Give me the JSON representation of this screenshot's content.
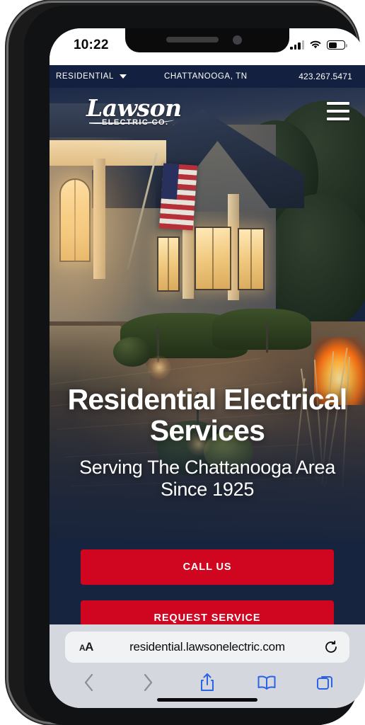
{
  "status_bar": {
    "time": "10:22",
    "signal_icon": "cellular-signal-icon",
    "wifi_icon": "wifi-icon",
    "battery_icon": "battery-icon"
  },
  "site": {
    "utility_bar": {
      "segment_label": "RESIDENTIAL",
      "segment_chevron_icon": "chevron-down-icon",
      "location": "CHATTANOOGA, TN",
      "phone": "423.267.5471"
    },
    "header": {
      "logo_script": "Lawson",
      "logo_subtitle": "ELECTRIC CO.",
      "menu_icon": "hamburger-menu-icon"
    },
    "hero": {
      "title": "Residential Electrical Services",
      "subtitle": "Serving The Chattanooga Area Since 1925",
      "cta_primary": "CALL US",
      "cta_secondary": "REQUEST SERVICE",
      "image_description": "Craftsman home at dusk with lit windows, American flag, illuminated stone patio and landscape lighting"
    }
  },
  "browser": {
    "text_size_icon": "text-size-aa-icon",
    "url": "residential.lawsonelectric.com",
    "reload_icon": "reload-icon",
    "toolbar": {
      "back_icon": "back-chevron-icon",
      "forward_icon": "forward-chevron-icon",
      "share_icon": "share-icon",
      "bookmarks_icon": "bookmarks-book-icon",
      "tabs_icon": "tabs-icon"
    }
  },
  "colors": {
    "brand_navy": "#14203F",
    "page_navy": "#17243F",
    "brand_red": "#D00520",
    "safari_chrome": "#D4D7DE",
    "safari_blue": "#2B63E8"
  }
}
